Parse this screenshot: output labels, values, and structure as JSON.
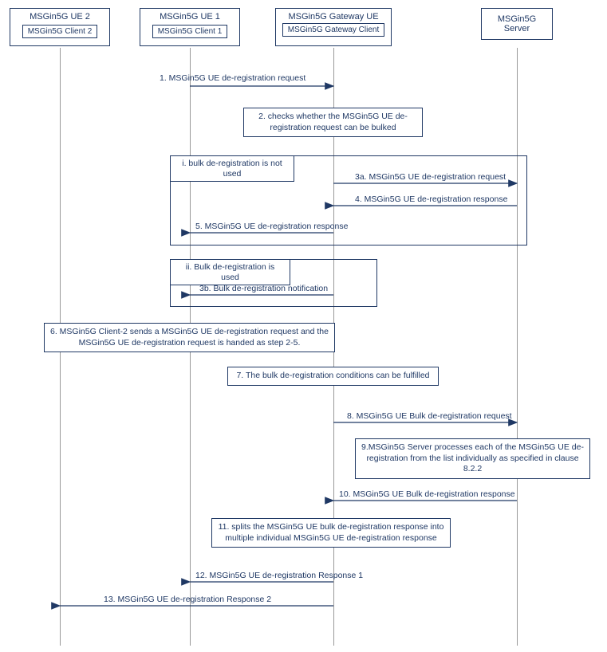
{
  "actors": {
    "ue2": {
      "title": "MSGin5G UE 2",
      "client": "MSGin5G Client 2"
    },
    "ue1": {
      "title": "MSGin5G UE 1",
      "client": "MSGin5G Client 1"
    },
    "gateway": {
      "title": "MSGin5G Gateway UE",
      "client": "MSGin5G Gateway Client"
    },
    "server": {
      "title": "MSGin5G Server"
    }
  },
  "messages": {
    "m1": "1. MSGin5G UE de-registration request",
    "m2": "2. checks whether the MSGin5G UE de-registration request can be bulked",
    "alt1_label": "i. bulk de-registration is not used",
    "m3a": "3a. MSGin5G UE de-registration request",
    "m4": "4. MSGin5G UE de-registration response",
    "m5": "5. MSGin5G UE de-registration response",
    "alt2_label": "ii. Bulk de-registration is used",
    "m3b": "3b. Bulk de-registration notification",
    "m6": "6. MSGin5G Client-2 sends a MSGin5G UE de-registration request and the MSGin5G UE de-registration request is handed as step 2-5.",
    "m7": "7. The bulk de-registration conditions can be fulfilled",
    "m8": "8. MSGin5G UE Bulk de-registration request",
    "m9": "9.MSGin5G Server processes each of the MSGin5G UE de-registration from the list individually as specified in clause 8.2.2",
    "m10": "10. MSGin5G UE Bulk de-registration response",
    "m11": "11. splits the MSGin5G UE bulk de-registration response into multiple individual MSGin5G UE de-registration response",
    "m12": "12. MSGin5G UE de-registration Response 1",
    "m13": "13. MSGin5G UE de-registration Response 2"
  },
  "chart_data": {
    "type": "sequence-diagram",
    "title": "MSGin5G UE de-registration via Gateway",
    "participants": [
      {
        "id": "ue2",
        "name": "MSGin5G UE 2",
        "subcomponent": "MSGin5G Client 2"
      },
      {
        "id": "ue1",
        "name": "MSGin5G UE 1",
        "subcomponent": "MSGin5G Client 1"
      },
      {
        "id": "gw",
        "name": "MSGin5G Gateway UE",
        "subcomponent": "MSGin5G Gateway Client"
      },
      {
        "id": "srv",
        "name": "MSGin5G Server"
      }
    ],
    "steps": [
      {
        "n": "1",
        "from": "ue1",
        "to": "gw",
        "kind": "message",
        "label": "MSGin5G UE de-registration request"
      },
      {
        "n": "2",
        "at": "gw",
        "kind": "self-action",
        "label": "checks whether the MSGin5G UE de-registration request can be bulked"
      },
      {
        "kind": "alt",
        "branches": [
          {
            "guard": "bulk de-registration is not used",
            "steps": [
              {
                "n": "3a",
                "from": "gw",
                "to": "srv",
                "kind": "message",
                "label": "MSGin5G UE de-registration request"
              },
              {
                "n": "4",
                "from": "srv",
                "to": "gw",
                "kind": "message",
                "label": "MSGin5G UE de-registration response"
              },
              {
                "n": "5",
                "from": "gw",
                "to": "ue1",
                "kind": "message",
                "label": "MSGin5G UE de-registration response"
              }
            ]
          },
          {
            "guard": "Bulk de-registration is used",
            "steps": [
              {
                "n": "3b",
                "from": "gw",
                "to": "ue1",
                "kind": "message",
                "label": "Bulk de-registration notification"
              }
            ]
          }
        ]
      },
      {
        "n": "6",
        "at": "ue2",
        "kind": "note",
        "label": "MSGin5G Client-2 sends a MSGin5G UE de-registration request and the MSGin5G UE de-registration request is handed as step 2-5."
      },
      {
        "n": "7",
        "at": "gw",
        "kind": "self-action",
        "label": "The bulk de-registration conditions can be fulfilled"
      },
      {
        "n": "8",
        "from": "gw",
        "to": "srv",
        "kind": "message",
        "label": "MSGin5G UE Bulk de-registration request"
      },
      {
        "n": "9",
        "at": "srv",
        "kind": "self-action",
        "label": "MSGin5G Server processes each of the MSGin5G UE de-registration from the list individually as specified in clause 8.2.2"
      },
      {
        "n": "10",
        "from": "srv",
        "to": "gw",
        "kind": "message",
        "label": "MSGin5G UE Bulk de-registration response"
      },
      {
        "n": "11",
        "at": "gw",
        "kind": "self-action",
        "label": "splits the MSGin5G UE bulk de-registration response into multiple individual MSGin5G UE de-registration response"
      },
      {
        "n": "12",
        "from": "gw",
        "to": "ue1",
        "kind": "message",
        "label": "MSGin5G UE de-registration Response 1"
      },
      {
        "n": "13",
        "from": "gw",
        "to": "ue2",
        "kind": "message",
        "label": "MSGin5G UE de-registration Response 2"
      }
    ]
  }
}
